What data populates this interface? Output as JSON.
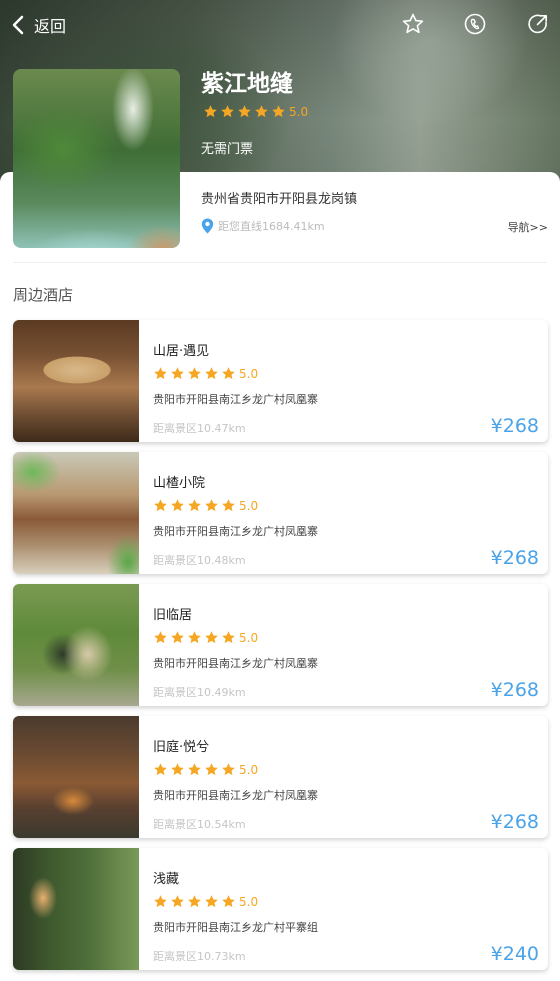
{
  "header": {
    "back_label": "返回"
  },
  "spot": {
    "title": "紫江地缝",
    "rating": "5.0",
    "ticket": "无需门票",
    "address": "贵州省贵阳市开阳县龙岗镇",
    "distance": "距您直线1684.41km",
    "nav_label": "导航>>"
  },
  "section": {
    "title": "周边酒店"
  },
  "hotels": [
    {
      "name": "山居·遇见",
      "rating": "5.0",
      "address": "贵阳市开阳县南江乡龙广村凤凰寨",
      "distance": "距离景区10.47km",
      "price": "¥268"
    },
    {
      "name": "山楂小院",
      "rating": "5.0",
      "address": "贵阳市开阳县南江乡龙广村凤凰寨",
      "distance": "距离景区10.48km",
      "price": "¥268"
    },
    {
      "name": "旧临居",
      "rating": "5.0",
      "address": "贵阳市开阳县南江乡龙广村凤凰寨",
      "distance": "距离景区10.49km",
      "price": "¥268"
    },
    {
      "name": "旧庭·悦兮",
      "rating": "5.0",
      "address": "贵阳市开阳县南江乡龙广村凤凰寨",
      "distance": "距离景区10.54km",
      "price": "¥268"
    },
    {
      "name": "浅藏",
      "rating": "5.0",
      "address": "贵阳市开阳县南江乡龙广村平寨组",
      "distance": "距离景区10.73km",
      "price": "¥240"
    }
  ],
  "colors": {
    "star": "#f5a623",
    "price": "#4aa3e8",
    "location_pin": "#4aa3e8"
  }
}
